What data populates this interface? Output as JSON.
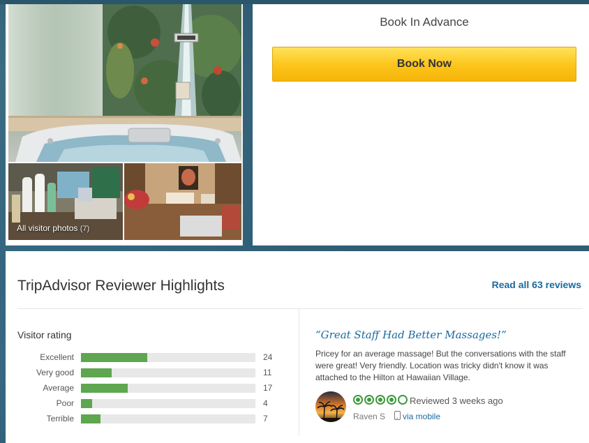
{
  "booking": {
    "heading": "Book In Advance",
    "button_label": "Book Now"
  },
  "photos": {
    "label": "All visitor photos",
    "count": "(7)"
  },
  "highlights": {
    "title": "TripAdvisor Reviewer Highlights",
    "read_all_label": "Read all 63 reviews",
    "rating_heading": "Visitor rating",
    "ratings": [
      {
        "label": "Excellent",
        "count": "24",
        "value": 24
      },
      {
        "label": "Very good",
        "count": "11",
        "value": 11
      },
      {
        "label": "Average",
        "count": "17",
        "value": 17
      },
      {
        "label": "Poor",
        "count": "4",
        "value": 4
      },
      {
        "label": "Terrible",
        "count": "7",
        "value": 7
      }
    ],
    "rating_max": 63
  },
  "review": {
    "quote": "“Great Staff Had Better Massages!”",
    "text": "Pricey for an average massage! But the conversations with the staff were great! Very friendly. Location was tricky didn't know it was attached to the Hilton at Hawaiian Village.",
    "bubble_rating": 4,
    "bubble_max": 5,
    "reviewed_date": "Reviewed 3 weeks ago",
    "reviewer_name": "Raven S",
    "via_label": "via mobile"
  },
  "colors": {
    "accent_link": "#1a6aa0",
    "bar_fill": "#5ea64f",
    "bubble_green": "#3d9a3d",
    "book_button": "#fcc419"
  }
}
